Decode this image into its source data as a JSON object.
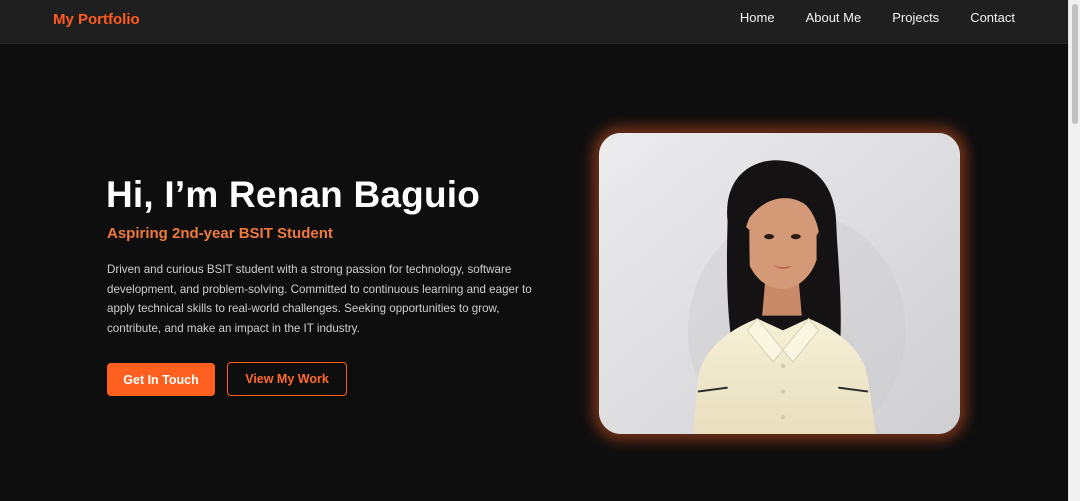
{
  "nav": {
    "brand": "My Portfolio",
    "links": [
      "Home",
      "About Me",
      "Projects",
      "Contact"
    ]
  },
  "hero": {
    "title": "Hi, I’m Renan Baguio",
    "subtitle": "Aspiring 2nd-year BSIT Student",
    "description": "Driven and curious BSIT student with a strong passion for technology, software development, and problem-solving. Committed to continuous learning and eager to apply technical skills to real-world challenges. Seeking opportunities to grow, contribute, and make an impact in the IT industry.",
    "primary_button": "Get In Touch",
    "secondary_button": "View My Work"
  },
  "colors": {
    "accent": "#ff5f1f",
    "background": "#0e0e0f",
    "navbar": "#1f1f1f",
    "subtitle": "#f07a3e"
  }
}
